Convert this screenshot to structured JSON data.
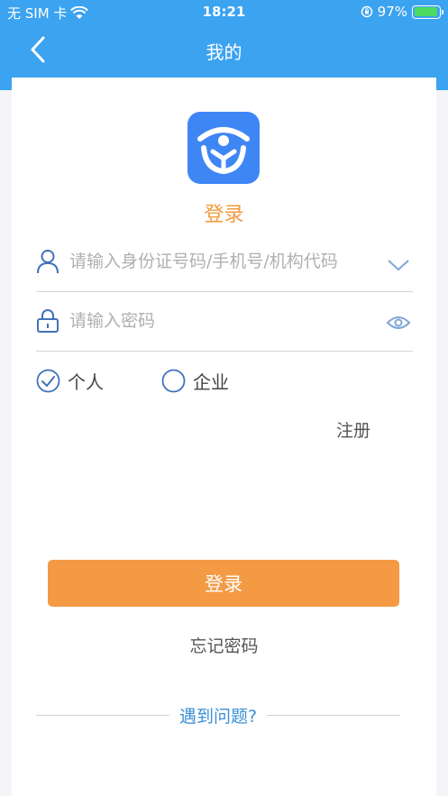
{
  "status_bar": {
    "carrier": "无 SIM 卡",
    "time": "18:21",
    "battery": "97%"
  },
  "nav": {
    "title": "我的"
  },
  "login": {
    "title": "登录",
    "account_placeholder": "请输入身份证号码/手机号/机构代码",
    "password_placeholder": "请输入密码",
    "radio_personal": "个人",
    "radio_enterprise": "企业",
    "register": "注册",
    "submit": "登录",
    "forgot": "忘记密码",
    "help": "遇到问题?"
  },
  "colors": {
    "header_blue": "#3ba3f0",
    "accent_orange": "#f49a45",
    "logo_blue": "#3f86f5",
    "help_blue": "#3b8fd6"
  }
}
